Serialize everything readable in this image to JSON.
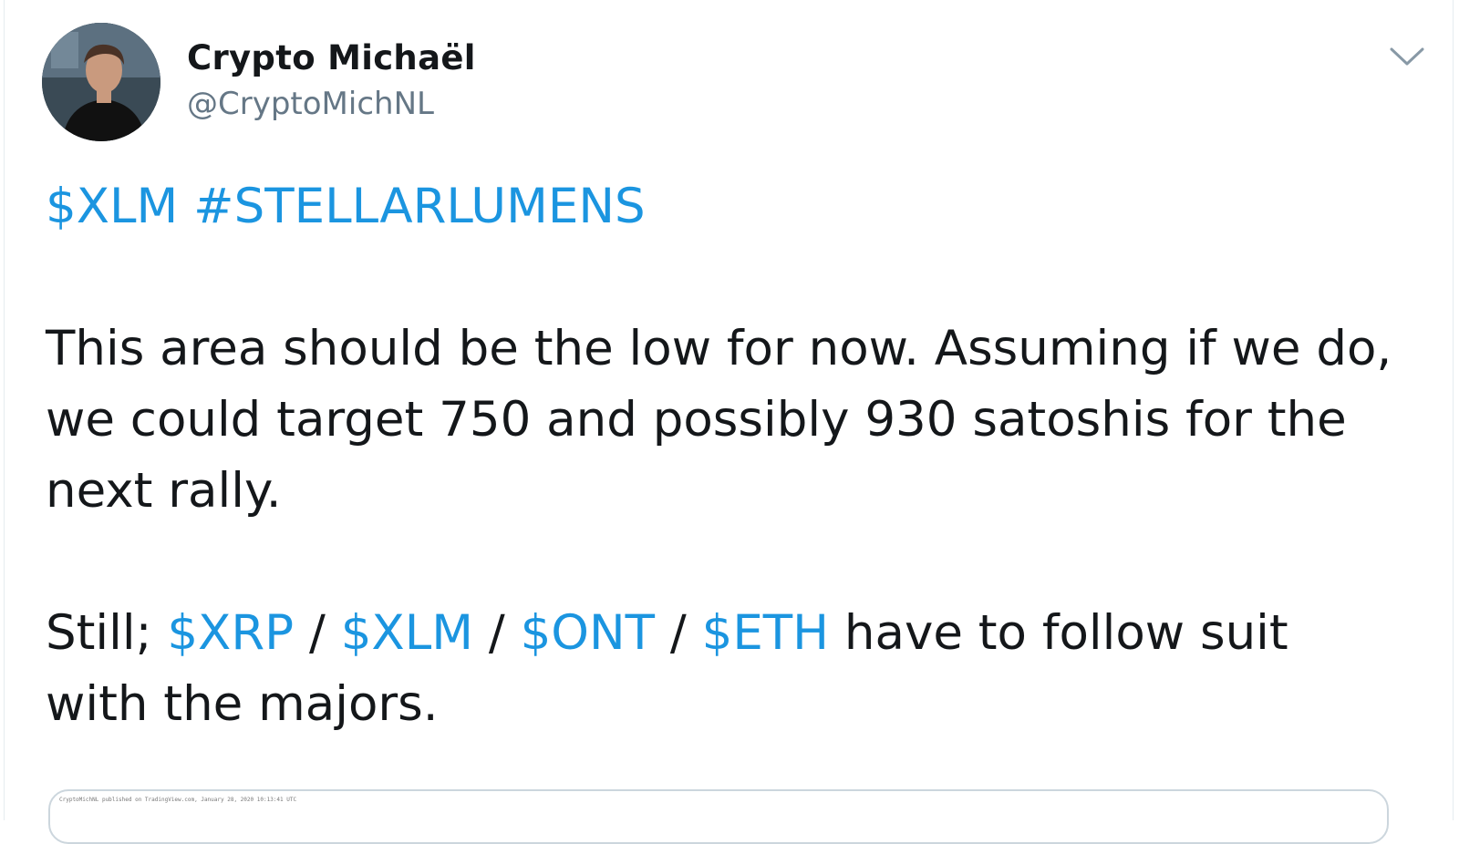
{
  "author": {
    "name": "Crypto Michaël",
    "handle": "@CryptoMichNL"
  },
  "tweet": {
    "tags": [
      {
        "text": "$XLM",
        "type": "cashtag"
      },
      {
        "text": "#STELLARLUMENS",
        "type": "hashtag"
      }
    ],
    "paragraph1": {
      "line1": "This area should be the low for now. Assuming if we do,",
      "line2": "we could target 750 and possibly 930 satoshis for the",
      "line3": "next rally."
    },
    "paragraph2": {
      "prefix": "Still; ",
      "cashtags": [
        "$XRP",
        "$XLM",
        "$ONT",
        "$ETH"
      ],
      "separator": " / ",
      "suffix_line1": " have to follow suit",
      "line2": "with the majors."
    }
  },
  "media": {
    "caption": "CryptoMichNL published on TradingView.com, January 28, 2020 10:13:41 UTC"
  },
  "icons": {
    "menu": "chevron-down-icon"
  },
  "colors": {
    "link": "#1b95e0",
    "text": "#14171a",
    "secondary": "#657786",
    "border": "#ccd6dd"
  }
}
